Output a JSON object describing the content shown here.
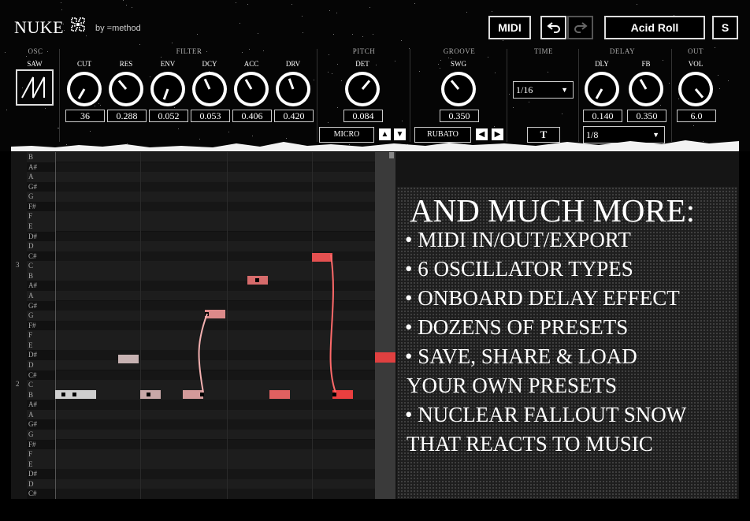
{
  "app": {
    "title": "NUKE",
    "byline": "by =method"
  },
  "header": {
    "midi_label": "MIDI",
    "undo_icon": "undo-arrow-icon",
    "redo_icon": "redo-arrow-icon",
    "preset_name": "Acid Roll",
    "save_label": "S"
  },
  "sections": {
    "osc": "OSC",
    "filter": "FILTER",
    "pitch": "PITCH",
    "groove": "GROOVE",
    "time": "TIME",
    "delay": "DELAY",
    "out": "OUT"
  },
  "osc": {
    "label": "SAW",
    "icon": "saw-wave-icon"
  },
  "knobs": {
    "cut": {
      "label": "CUT",
      "value": "36"
    },
    "res": {
      "label": "RES",
      "value": "0.288"
    },
    "env": {
      "label": "ENV",
      "value": "0.052"
    },
    "dcy": {
      "label": "DCY",
      "value": "0.053"
    },
    "acc": {
      "label": "ACC",
      "value": "0.406"
    },
    "drv": {
      "label": "DRV",
      "value": "0.420"
    },
    "det": {
      "label": "DET",
      "value": "0.084"
    },
    "swg": {
      "label": "SWG",
      "value": "0.350"
    },
    "dly": {
      "label": "DLY",
      "value": "0.140"
    },
    "fb": {
      "label": "FB",
      "value": "0.350"
    },
    "vol": {
      "label": "VOL",
      "value": "6.0"
    }
  },
  "pitch_controls": {
    "micro_label": "MICRO",
    "up_icon": "triangle-up-icon",
    "down_icon": "triangle-down-icon"
  },
  "groove_controls": {
    "rubato_label": "RUBATO",
    "left_icon": "triangle-left-icon",
    "right_icon": "triangle-right-icon"
  },
  "time": {
    "selected": "1/16",
    "tap_label": "T"
  },
  "delay": {
    "selected": "1/8"
  },
  "piano_roll": {
    "keys": [
      "B",
      "A#",
      "A",
      "G#",
      "G",
      "F#",
      "F",
      "E",
      "D#",
      "D",
      "C#",
      "C",
      "B",
      "A#",
      "A",
      "G#",
      "G",
      "F#",
      "F",
      "E",
      "D#",
      "D",
      "C#",
      "C",
      "B",
      "A#",
      "A",
      "G#",
      "G",
      "F#",
      "F",
      "E",
      "D#",
      "D",
      "C#"
    ],
    "octave_labels": [
      {
        "label": "3",
        "key_index": 11
      },
      {
        "label": "2",
        "key_index": 23
      }
    ]
  },
  "promo": {
    "heading": "AND MUCH MORE:",
    "lines": [
      "• MIDI IN/OUT/EXPORT",
      "• 6 OSCILLATOR TYPES",
      "• ONBOARD DELAY EFFECT",
      "• DOZENS OF PRESETS",
      "• SAVE, SHARE & LOAD",
      "YOUR OWN PRESETS",
      "• NUCLEAR FALLOUT SNOW",
      "THAT REACTS TO MUSIC"
    ]
  }
}
